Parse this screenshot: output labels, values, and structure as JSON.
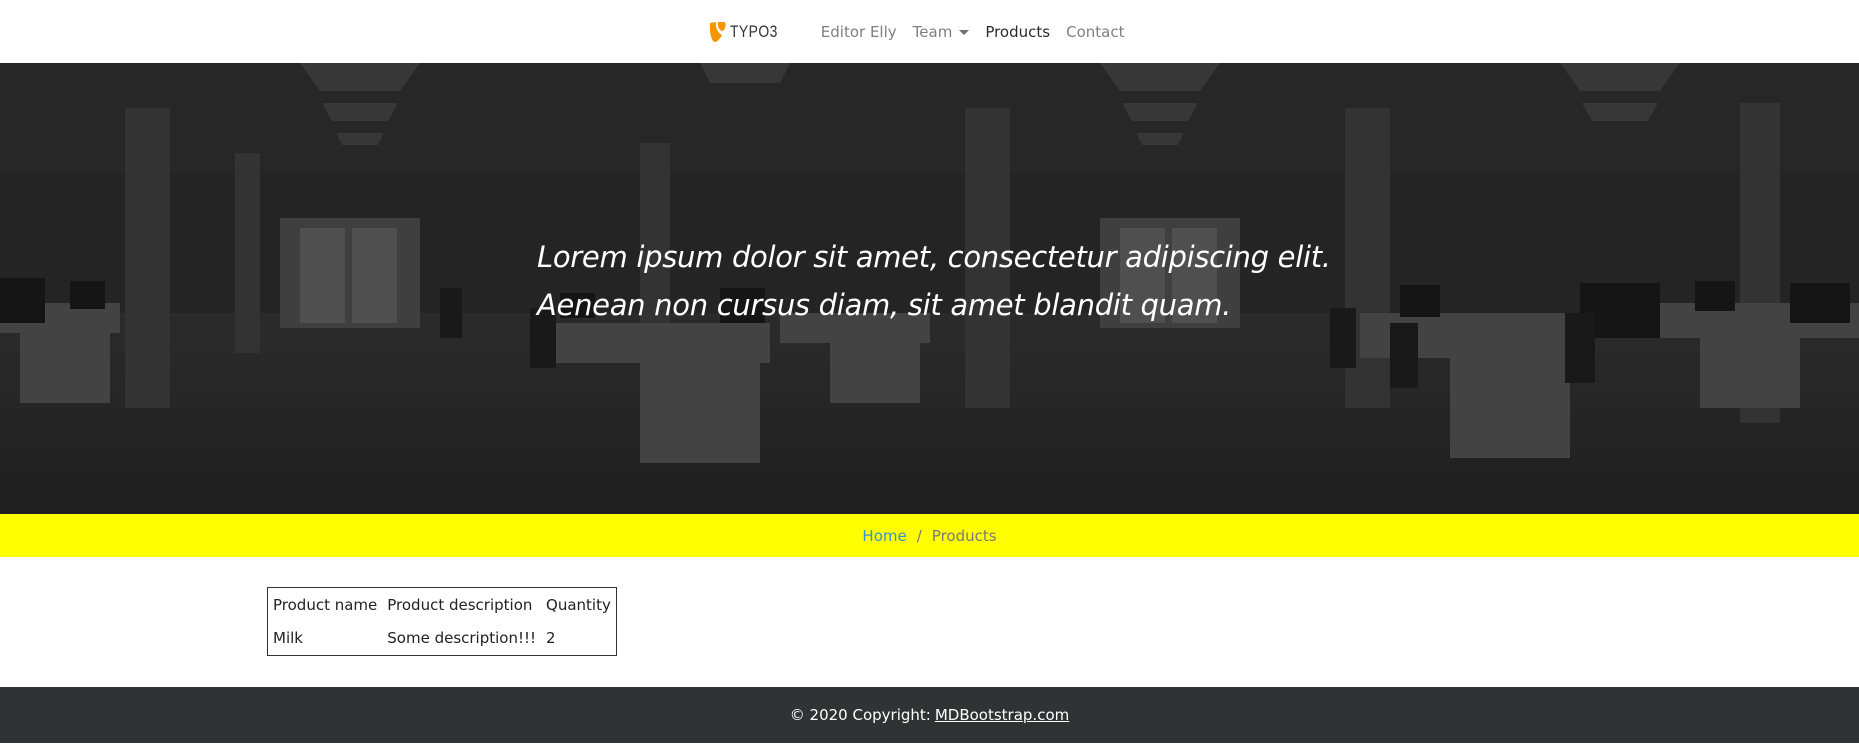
{
  "navbar": {
    "brand": "TYPO3",
    "items": [
      {
        "label": "Editor Elly"
      },
      {
        "label": "Team"
      },
      {
        "label": "Products"
      },
      {
        "label": "Contact"
      }
    ]
  },
  "hero": {
    "line1": "Lorem ipsum dolor sit amet, consectetur adipiscing elit.",
    "line2": "Aenean non cursus diam, sit amet blandit quam."
  },
  "breadcrumb": {
    "home": "Home",
    "separator": "/",
    "current": "Products"
  },
  "table": {
    "headers": [
      "Product name",
      "Product description",
      "Quantity"
    ],
    "rows": [
      [
        "Milk",
        "Some description!!!",
        "2"
      ]
    ]
  },
  "footer": {
    "text": "© 2020 Copyright:",
    "link": "MDBootstrap.com"
  },
  "colors": {
    "breadcrumb_bg": "#ffff00",
    "footer_bg": "#313233",
    "brand_orange": "#f49700",
    "link_blue": "#3b8fd6"
  }
}
